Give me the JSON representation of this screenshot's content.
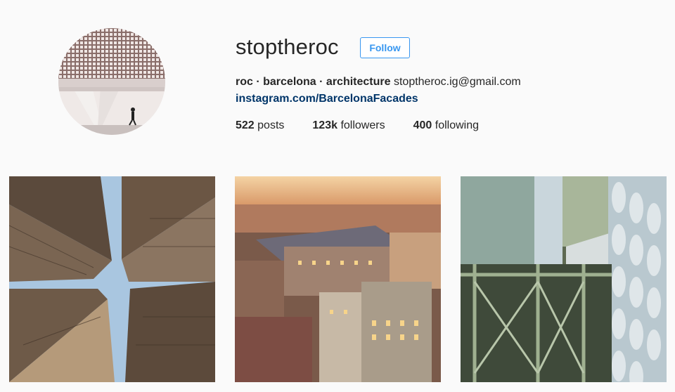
{
  "profile": {
    "username": "stoptheroc",
    "follow_label": "Follow",
    "bio_name": "roc · barcelona · architecture",
    "bio_email": "stoptheroc.ig@gmail.com",
    "link": "instagram.com/BarcelonaFacades",
    "stats": {
      "posts_count": "522",
      "posts_label": "posts",
      "followers_count": "123k",
      "followers_label": "followers",
      "following_count": "400",
      "following_label": "following"
    }
  },
  "colors": {
    "accent": "#3897f0",
    "link": "#003569",
    "background": "#fafafa"
  }
}
